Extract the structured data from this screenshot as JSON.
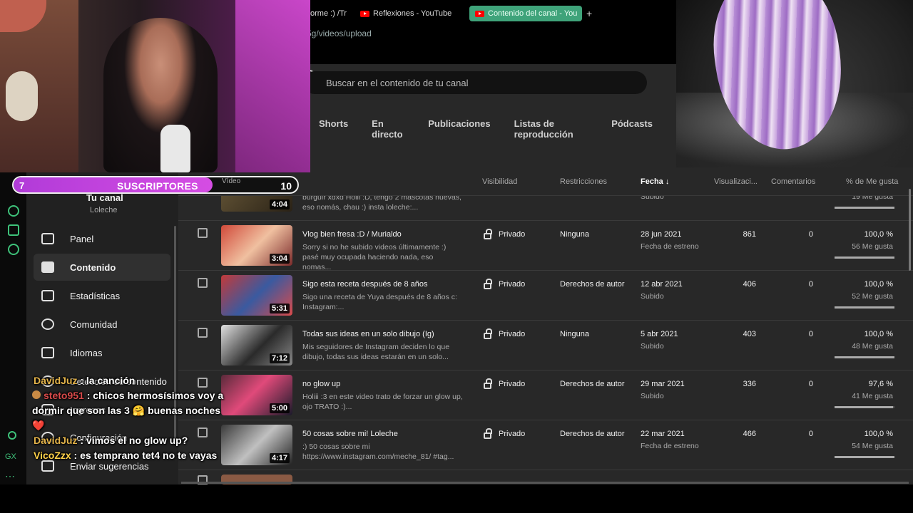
{
  "browser": {
    "tabs": [
      {
        "label": "orme :) /Tr"
      },
      {
        "label": "Reflexiones - YouTube"
      },
      {
        "label": "Contenido del canal - You"
      }
    ],
    "new_tab": "+",
    "url": "5g/videos/upload"
  },
  "studio": {
    "search_placeholder": "Buscar en el contenido de tu canal",
    "content_tabs": [
      "Shorts",
      "En directo",
      "Publicaciones",
      "Listas de reproducción",
      "Pódcasts"
    ]
  },
  "subgoal": {
    "current": "7",
    "label": "SUSCRIPTORES",
    "goal": "10",
    "progress": 0.7,
    "peek_header": "Vídeo"
  },
  "channel": {
    "name": "Tu canal",
    "handle": "Loleche"
  },
  "sidebar": {
    "items": [
      {
        "label": "Panel",
        "icon": "dashboard-icon"
      },
      {
        "label": "Contenido",
        "icon": "content-icon",
        "active": true
      },
      {
        "label": "Estadísticas",
        "icon": "analytics-icon"
      },
      {
        "label": "Comunidad",
        "icon": "community-icon"
      },
      {
        "label": "Idiomas",
        "icon": "subtitles-icon"
      },
      {
        "label": "Detección de contenido",
        "icon": "copyright-icon"
      },
      {
        "label": "Ingresos",
        "icon": "earn-icon"
      },
      {
        "label": "Configuración",
        "icon": "settings-icon"
      },
      {
        "label": "Enviar sugerencias",
        "icon": "feedback-icon"
      }
    ]
  },
  "table": {
    "headers": {
      "visibility": "Visibilidad",
      "restrictions": "Restricciones",
      "date": "Fecha",
      "views": "Visualizaci...",
      "comments": "Comentarios",
      "likes": "% de Me gusta"
    },
    "partial_row": {
      "duration": "4:04",
      "desc": "burguir xdxd Holii :D, tengo 2 mascotas nuevas, eso nomás, chau :) insta loleche:...",
      "date_type": "Subido",
      "likes": "19 Me gusta"
    },
    "rows": [
      {
        "title": "Vlog bien fresa :D / Murialdo",
        "desc": "Sorry si no he subido videos últimamente :) pasé muy ocupada haciendo nada, eso nomas...",
        "duration": "3:04",
        "visibility": "Privado",
        "restrictions": "Ninguna",
        "date": "28 jun 2021",
        "date_type": "Fecha de estreno",
        "views": "861",
        "comments": "0",
        "like_pct": "100,0 %",
        "likes": "56 Me gusta",
        "ratio": 1.0
      },
      {
        "title": "Sigo esta receta después de 8 años",
        "desc": "Sigo una receta de Yuya después de 8 años c: Instagram:...",
        "duration": "5:31",
        "visibility": "Privado",
        "restrictions": "Derechos de autor",
        "date": "12 abr 2021",
        "date_type": "Subido",
        "views": "406",
        "comments": "0",
        "like_pct": "100,0 %",
        "likes": "52 Me gusta",
        "ratio": 1.0
      },
      {
        "title": "Todas sus ideas en un solo dibujo (Ig)",
        "desc": "Mis seguidores de Instagram deciden lo que dibujo, todas sus ideas estarán en un solo...",
        "duration": "7:12",
        "visibility": "Privado",
        "restrictions": "Ninguna",
        "date": "5 abr 2021",
        "date_type": "Subido",
        "views": "403",
        "comments": "0",
        "like_pct": "100,0 %",
        "likes": "48 Me gusta",
        "ratio": 1.0
      },
      {
        "title": "no glow up",
        "desc": "Holiii :3 en este video trato de forzar un glow up, ojo TRATO :)...",
        "duration": "5:00",
        "visibility": "Privado",
        "restrictions": "Derechos de autor",
        "date": "29 mar 2021",
        "date_type": "Subido",
        "views": "336",
        "comments": "0",
        "like_pct": "97,6 %",
        "likes": "41 Me gusta",
        "ratio": 0.976
      },
      {
        "title": "50 cosas sobre mi! Loleche",
        "desc": ":) 50 cosas sobre mi https://www.instagram.com/meche_81/ #tag...",
        "duration": "4:17",
        "visibility": "Privado",
        "restrictions": "Derechos de autor",
        "date": "22 mar 2021",
        "date_type": "Fecha de estreno",
        "views": "466",
        "comments": "0",
        "like_pct": "100,0 %",
        "likes": "54 Me gusta",
        "ratio": 1.0
      }
    ]
  },
  "chat": [
    {
      "user": "DavidJuz",
      "text": ": la canción"
    },
    {
      "user": "steto951",
      "text": ": chicos hermosísimos voy a dormir que son las 3 🤗 buenas noches ❤️"
    },
    {
      "user": "DavidJuz",
      "text": ": vimos el no glow up?"
    },
    {
      "user": "VicoZzx",
      "text": ": es temprano tet4 no te vayas"
    }
  ],
  "rail": {
    "label": "GX"
  },
  "colors": {
    "accent": "#3fa37a",
    "subgoal": "#c446dd",
    "background": "#282828"
  }
}
